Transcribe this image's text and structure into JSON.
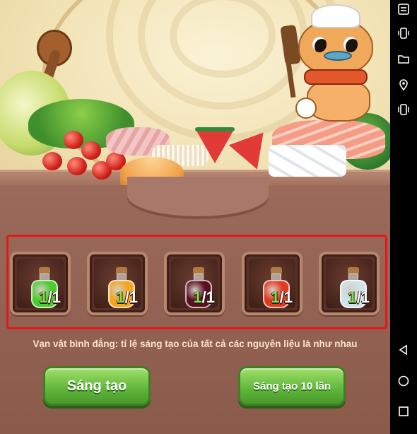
{
  "ingredients": [
    {
      "name": "green-potion",
      "have": "1",
      "need": "/1",
      "color": "#4ccc2e"
    },
    {
      "name": "orange-jar",
      "have": "1",
      "need": "/1",
      "color": "#f5a51f"
    },
    {
      "name": "dark-red-bottle",
      "have": "1",
      "need": "/1",
      "color": "#5a1020"
    },
    {
      "name": "red-potion",
      "have": "1",
      "need": "/1",
      "color": "#e23a20"
    },
    {
      "name": "crystal-jar",
      "have": "1",
      "need": "/1",
      "color": "#cfe4ea"
    }
  ],
  "info_text": "Vạn vật bình đẳng: tỉ lệ sáng tạo của tất cả các nguyên liệu là như nhau",
  "buttons": {
    "create_once": "Sáng tạo",
    "create_ten": "Sáng tạo 10 lần"
  },
  "colors": {
    "highlight": "#e01a1a",
    "button_green": "#5fb53a",
    "panel": "#8a5a4b"
  },
  "navbar": {
    "top_icons": [
      "menu-icon",
      "vibrate-icon",
      "folder-icon",
      "location-icon",
      "rotate-icon"
    ],
    "bottom_icons": [
      "back-icon",
      "home-icon",
      "recents-icon"
    ]
  }
}
